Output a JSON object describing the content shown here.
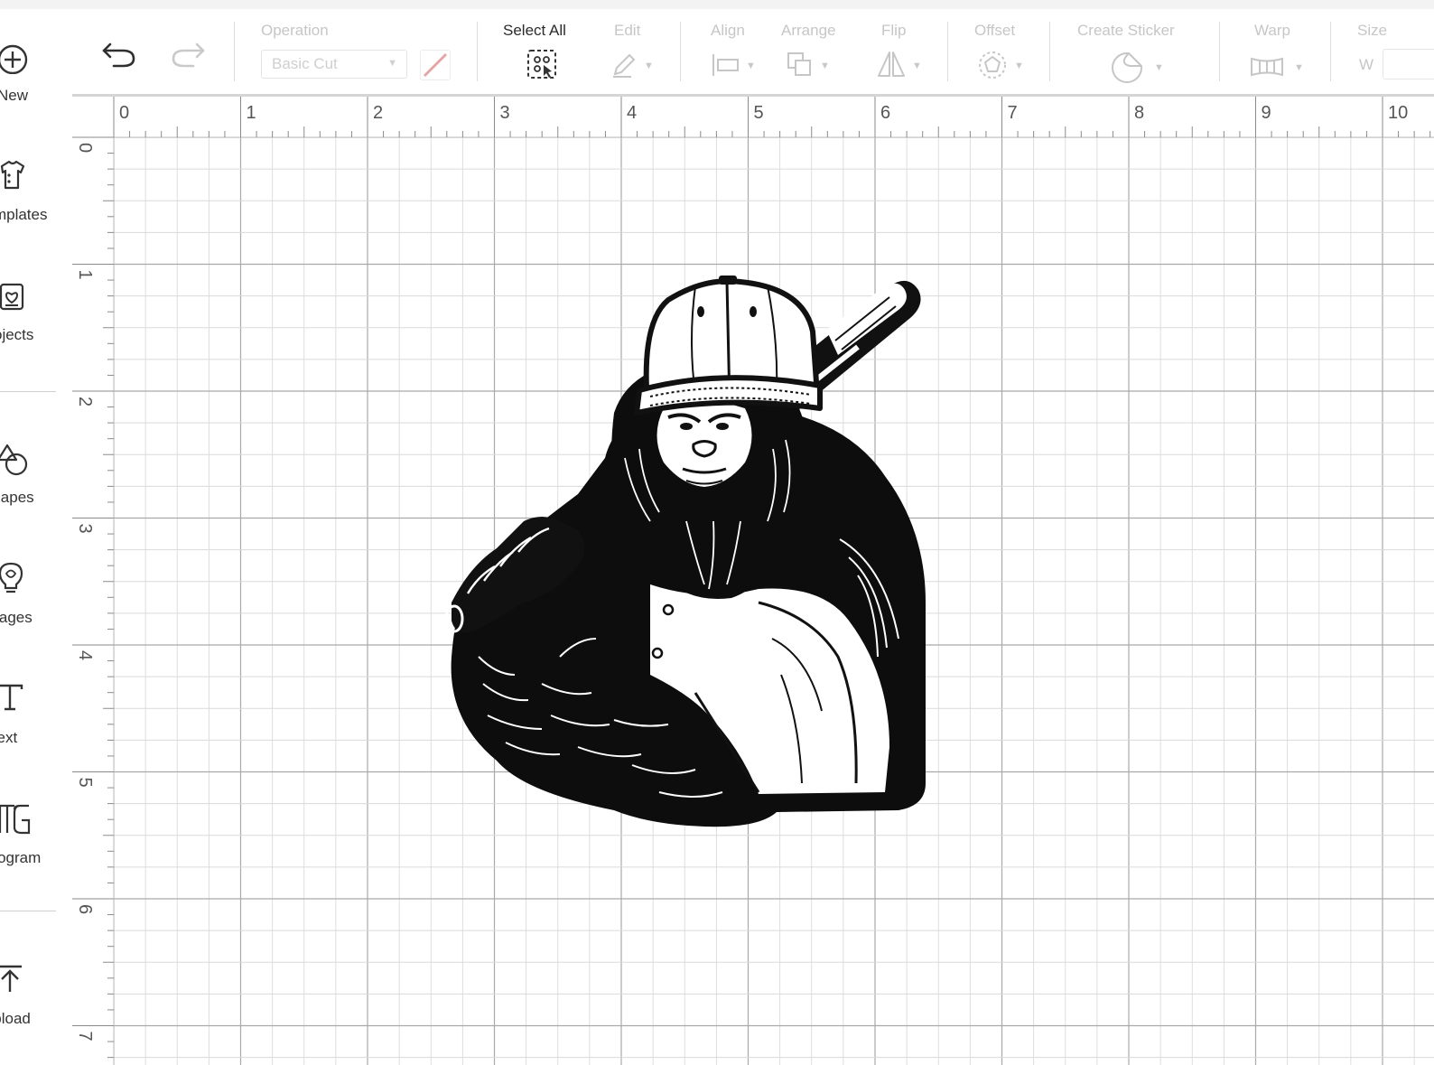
{
  "sidebar": {
    "items": [
      {
        "label": "New",
        "icon": "plus-circle-icon"
      },
      {
        "label": "Templates",
        "icon": "shirt-icon"
      },
      {
        "label": "Projects",
        "icon": "projects-icon"
      },
      {
        "label": "Shapes",
        "icon": "shapes-icon"
      },
      {
        "label": "Images",
        "icon": "lightbulb-icon"
      },
      {
        "label": "Text",
        "icon": "text-icon"
      },
      {
        "label": "Monogram",
        "icon": "monogram-icon"
      },
      {
        "label": "Upload",
        "icon": "upload-icon"
      }
    ]
  },
  "toolbar": {
    "undo_icon": "undo-icon",
    "redo_icon": "redo-icon",
    "operation_label": "Operation",
    "operation_value": "Basic Cut",
    "select_all_label": "Select All",
    "edit_label": "Edit",
    "align_label": "Align",
    "arrange_label": "Arrange",
    "flip_label": "Flip",
    "offset_label": "Offset",
    "create_sticker_label": "Create Sticker",
    "warp_label": "Warp",
    "size_label": "Size",
    "size_w_label": "W"
  },
  "canvas": {
    "ruler_top": [
      "0",
      "1",
      "2",
      "3",
      "4",
      "5",
      "6",
      "7",
      "8",
      "9",
      "10"
    ],
    "ruler_left": [
      "0",
      "1",
      "2",
      "3",
      "4",
      "5",
      "6",
      "7"
    ],
    "image_subject": "gorilla-baseball-player"
  },
  "colors": {
    "grid_major": "#a9a9a9",
    "grid_minor": "#dadada",
    "disabled_text": "#c6c6c6",
    "active_text": "#2b2b2b",
    "swatch_slash": "#e6a6a6"
  }
}
